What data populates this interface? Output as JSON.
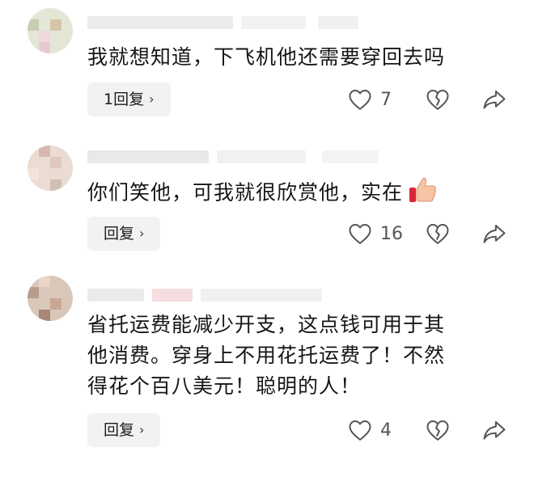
{
  "comments": [
    {
      "text": "我就想知道，下飞机他还需要穿回去吗",
      "reply_label": "1回复",
      "like_count": "7"
    },
    {
      "text": "你们笑他，可我就很欣赏他，实在",
      "text_emoji": "thumbs-up-emoji",
      "reply_label": "回复",
      "like_count": "16"
    },
    {
      "text_lines": [
        "省托运费能减少开支，这点钱可用于其",
        "他消费。穿身上不用花托运费了！不然",
        "得花个百八美元！聪明的人！"
      ],
      "reply_label": "回复",
      "like_count": "4"
    }
  ],
  "reply_chevron": "›",
  "icons": {
    "like": "heart-outline-icon",
    "dislike": "broken-heart-icon",
    "share": "share-arrow-icon"
  },
  "colors": {
    "text": "#161616",
    "reply_bg": "#f2f2f2",
    "icon": "#555555"
  }
}
